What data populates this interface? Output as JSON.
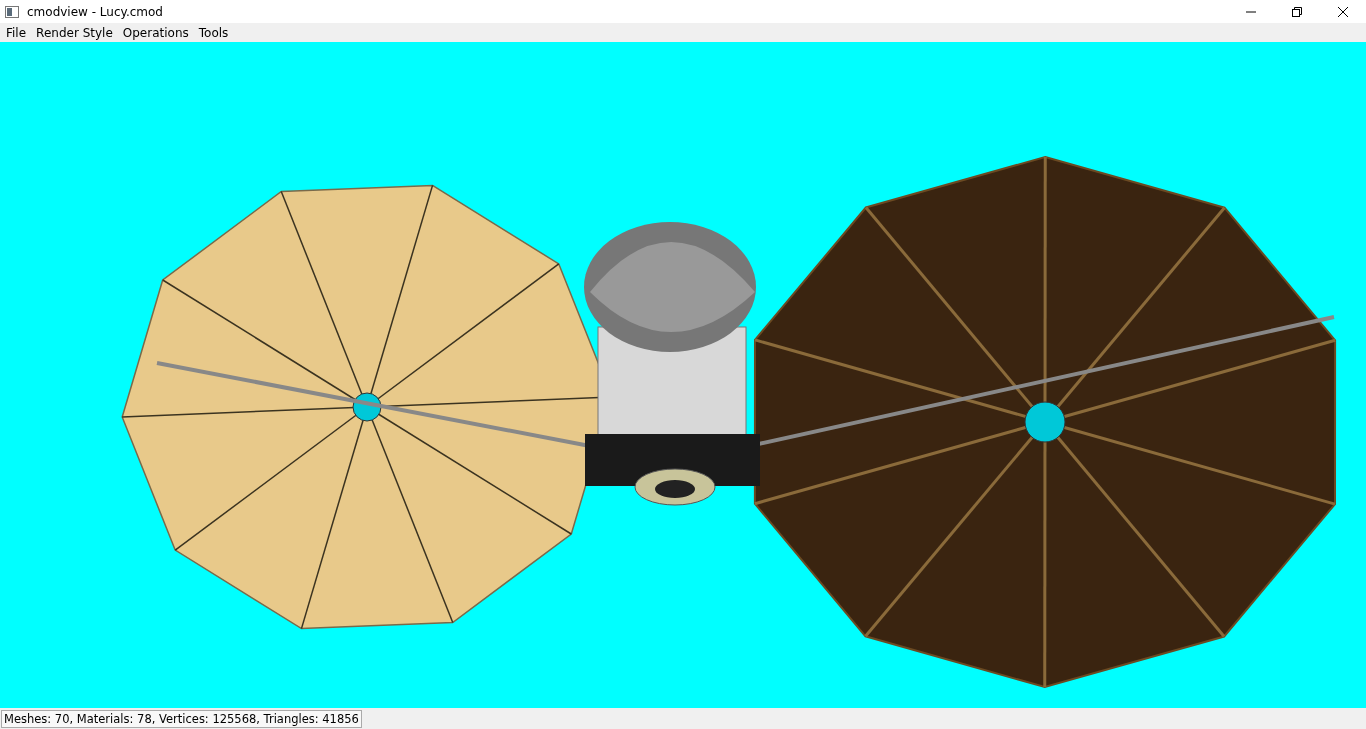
{
  "window": {
    "title": "cmodview - Lucy.cmod"
  },
  "menu": [
    "File",
    "Render Style",
    "Operations",
    "Tools"
  ],
  "status_bar": "Meshes: 70, Materials: 78, Vertices: 125568, Triangles: 41856"
}
